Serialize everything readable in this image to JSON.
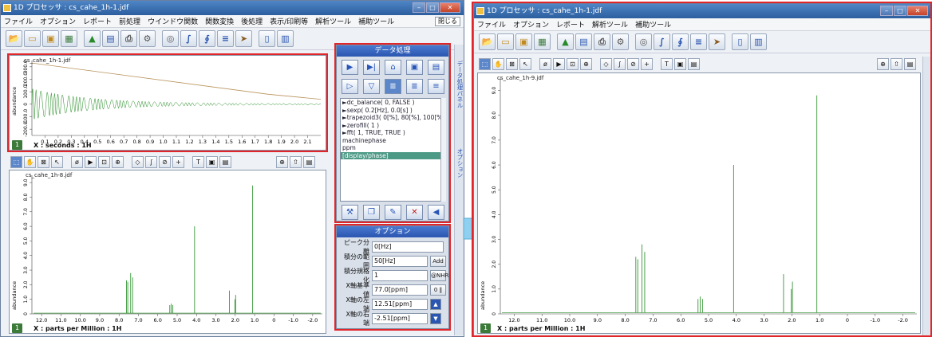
{
  "left_window": {
    "title": "1D プロセッサ : cs_cahe_1h-1.jdf",
    "close_label": "閉じる",
    "menu": [
      "ファイル",
      "オプション",
      "レポート",
      "前処理",
      "ウインドウ関数",
      "関数変換",
      "後処理",
      "表示/印刷等",
      "解析ツール",
      "補助ツール"
    ],
    "fid_plot": {
      "file_label": "cs_cahe_1h-1.jdf",
      "y_axis_label": "abundance",
      "y_ticks": [
        "300.0",
        "200.0",
        "100.0",
        "0",
        "-100.0",
        "-200.0"
      ],
      "x_ticks": [
        "0.1",
        "0.2",
        "0.3",
        "0.4",
        "0.5",
        "0.6",
        "0.7",
        "0.8",
        "0.9",
        "1.0",
        "1.1",
        "1.2",
        "1.3",
        "1.4",
        "1.5",
        "1.6",
        "1.7",
        "1.8",
        "1.9",
        "2.0",
        "2.1"
      ],
      "x_axis_label": "X : seconds : 1H",
      "badge": "1"
    },
    "spectrum_plot": {
      "file_label": "cs_cahe_1h-8.jdf",
      "y_axis_label": "abundance",
      "y_ticks": [
        "9.0",
        "8.0",
        "7.0",
        "6.0",
        "5.0",
        "4.0",
        "3.0",
        "2.0",
        "1.0",
        "0"
      ],
      "x_ticks": [
        "12.0",
        "11.0",
        "10.0",
        "9.0",
        "8.0",
        "7.0",
        "6.0",
        "5.0",
        "4.0",
        "3.0",
        "2.0",
        "1.0",
        "0",
        "-1.0",
        "-2.0"
      ],
      "x_axis_label": "X : parts per Million : 1H",
      "badge": "1"
    },
    "data_processing": {
      "header": "データ処理",
      "commands": [
        "►dc_balance( 0, FALSE )",
        "►sexp( 0.2[Hz], 0.0[s] )",
        "►trapezoid3( 0[%], 80[%], 100[%] )",
        "►zerofill( 1 )",
        "►fft( 1, TRUE, TRUE )",
        "  machinephase",
        "  ppm",
        "  [display/phase]"
      ],
      "selected_index": 7
    },
    "options": {
      "header": "オプション",
      "rows": [
        {
          "label": "ピーク分離",
          "value": "0[Hz]",
          "button": ""
        },
        {
          "label": "積分の範囲",
          "value": "50[Hz]",
          "button": "Add"
        },
        {
          "label": "積分規格化",
          "value": "1",
          "button": "@NHR"
        },
        {
          "label": "X軸基準値",
          "value": "77.0[ppm]",
          "button": "0 ‖"
        },
        {
          "label": "X軸の左端",
          "value": "12.51[ppm]",
          "button": "▲"
        },
        {
          "label": "X軸の右端",
          "value": "-2.51[ppm]",
          "button": "▼"
        }
      ]
    },
    "side_tabs": [
      "データ処理パネル",
      "オプション"
    ]
  },
  "right_window": {
    "title": "1D プロセッサ : cs_cahe_1h-1.jdf",
    "menu": [
      "ファイル",
      "オプション",
      "レポート",
      "解析ツール",
      "補助ツール"
    ],
    "spectrum_plot": {
      "file_label": "cs_cahe_1h-9.jdf",
      "y_axis_label": "abundance",
      "y_ticks": [
        "9.0",
        "8.0",
        "7.0",
        "6.0",
        "5.0",
        "4.0",
        "3.0",
        "2.0",
        "1.0",
        "0"
      ],
      "x_ticks": [
        "12.0",
        "11.0",
        "10.0",
        "9.0",
        "8.0",
        "7.0",
        "6.0",
        "5.0",
        "4.0",
        "3.0",
        "2.0",
        "1.0",
        "0",
        "-1.0",
        "-2.0"
      ],
      "x_axis_label": "X : parts per Million : 1H",
      "badge": "1"
    }
  },
  "colors": {
    "highlight_border": "#e0262a",
    "spectrum_line": "#1f8a1f",
    "fid_envelope": "#b8935a",
    "arrow": "#7ec8ea",
    "panel_header": "#2a55b0"
  },
  "icons": {
    "toolbar": [
      "open-folder-icon",
      "folder-icon",
      "open-file-icon",
      "image-icon",
      "peak-chart-icon",
      "save-icon",
      "print-icon",
      "settings-icon",
      "target-icon",
      "integral-icon",
      "formula-icon",
      "list-icon",
      "run-icon",
      "page-icon",
      "export-icon"
    ],
    "view_tools": [
      "select-icon",
      "hand-icon",
      "zoom-icon",
      "cursor-icon",
      "phase-icon",
      "play-icon",
      "scale-icon",
      "flip-icon",
      "peak-icon",
      "integral-icon",
      "edit-icon",
      "add-icon",
      "text-icon",
      "box-icon",
      "grid-icon"
    ]
  },
  "chart_data": [
    {
      "type": "line",
      "title": "cs_cahe_1h-1.jdf",
      "xlabel": "X : seconds : 1H",
      "ylabel": "abundance",
      "xlim": [
        0,
        2.2
      ],
      "ylim": [
        -250,
        350
      ],
      "series": [
        {
          "x": [
            0,
            1.8,
            2.2
          ],
          "y": [
            330,
            80,
            40
          ]
        }
      ]
    },
    {
      "type": "line",
      "title": "cs_cahe_1h-8.jdf",
      "xlabel": "X : parts per Million : 1H",
      "ylabel": "abundance",
      "xlim": [
        12.5,
        -2.5
      ],
      "ylim": [
        0,
        9.5
      ],
      "peaks_ppm": [
        7.62,
        7.55,
        7.4,
        7.3,
        5.38,
        5.3,
        5.22,
        4.1,
        2.3,
        2.02,
        1.98,
        1.1
      ],
      "peak_heights": [
        2.3,
        2.2,
        2.8,
        2.5,
        0.6,
        0.7,
        0.6,
        6.0,
        1.6,
        1.0,
        1.3,
        8.8
      ]
    },
    {
      "type": "line",
      "title": "cs_cahe_1h-9.jdf",
      "xlabel": "X : parts per Million : 1H",
      "ylabel": "abundance",
      "xlim": [
        12.5,
        -2.5
      ],
      "ylim": [
        0,
        9.5
      ],
      "peaks_ppm": [
        7.62,
        7.55,
        7.4,
        7.3,
        5.38,
        5.3,
        5.22,
        4.1,
        2.3,
        2.02,
        1.98,
        1.1
      ],
      "peak_heights": [
        2.3,
        2.2,
        2.8,
        2.5,
        0.6,
        0.7,
        0.6,
        6.0,
        1.6,
        1.0,
        1.3,
        8.8
      ]
    }
  ]
}
